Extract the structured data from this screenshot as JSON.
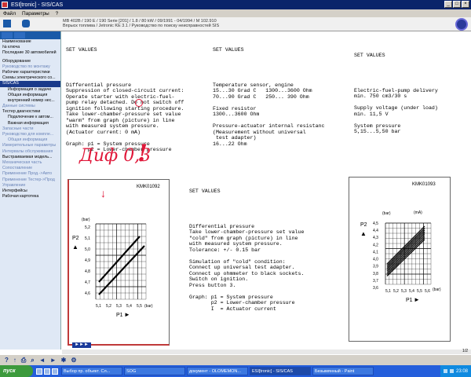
{
  "window": {
    "title": "ESI[tronic] - SIS/CAS"
  },
  "menu": [
    "Файл",
    "Параметры",
    "?"
  ],
  "header": {
    "info_line1": "MB 402B / 190 E / 190 Serie [201] / 1.8 / 80 kW / 09/1991 - 04/1994 / M 102.910",
    "info_line2": "Впрыск топлива / Jetronic KE 3.1 / Руководство по поиску неисправностей SIS"
  },
  "sidebar": {
    "items": [
      {
        "label": "Наименование",
        "style": ""
      },
      {
        "label": "№ ключа",
        "style": ""
      },
      {
        "label": "Последние 30 автомобилей",
        "style": ""
      },
      {
        "label": "",
        "style": "gap"
      },
      {
        "label": "Оборудование",
        "style": ""
      },
      {
        "label": "Руководство по монтажу",
        "style": "dim"
      },
      {
        "label": "Рабочие характеристики",
        "style": ""
      },
      {
        "label": "Схемы электрического со...",
        "style": ""
      },
      {
        "label": "SIS/CAS",
        "style": "sel"
      },
      {
        "label": "Информация о задаче",
        "style": "ind"
      },
      {
        "label": "Общая информация",
        "style": "ind"
      },
      {
        "label": "внутренний номер нес...",
        "style": "ind"
      },
      {
        "label": "Данные системы",
        "style": "dim"
      },
      {
        "label": "Тестер диагностики",
        "style": ""
      },
      {
        "label": "Подключение к автом...",
        "style": "ind"
      },
      {
        "label": "Важная информация",
        "style": "ind"
      },
      {
        "label": "Запасные части",
        "style": "dim"
      },
      {
        "label": "Руководство для компле...",
        "style": "dim"
      },
      {
        "label": "Общая информация",
        "style": "ind dim"
      },
      {
        "label": "Измерительные параметры",
        "style": "dim"
      },
      {
        "label": "Интервалы обслуживания",
        "style": "dim"
      },
      {
        "label": "Выстраиваемая модель...",
        "style": ""
      },
      {
        "label": "Механическая часть",
        "style": "dim"
      },
      {
        "label": "Сопоставление",
        "style": "dim"
      },
      {
        "label": "Применение Прод.->Авто",
        "style": "dim"
      },
      {
        "label": "Применение Тестер->Прод",
        "style": "dim"
      },
      {
        "label": "Управление",
        "style": "dim"
      },
      {
        "label": "Интерфейсы",
        "style": ""
      },
      {
        "label": "Рабочая картотека",
        "style": ""
      }
    ]
  },
  "panel_left": {
    "heading": "SET VALUES",
    "lines": [
      "Differential pressure",
      "Suppression of closed-circuit current:",
      "Operate starter with electric-fuel-",
      "pump relay detached. Do not switch off",
      "ignition following starting procedure.",
      "Take lower-chamber-pressure set value",
      "\"warm\" from graph (picture) in line",
      "with measured system pressure.",
      "(Actuator current: 0 mA)",
      "",
      "Graph: p1 = System pressure",
      "       p2 = Lower-chamber pressure"
    ]
  },
  "panel_mid": {
    "heading": "SET VALUES",
    "lines": [
      "Temperature sensor, engine",
      "15...30 Grad C   1300...3600 Ohm",
      "70...90 Grad C   250... 390 Ohm",
      "",
      "Fixed resistor",
      "1300...3600 Ohm",
      "",
      "Pressure-actuator internal resistanc",
      "(Measurement without universal",
      " test adapter)",
      "16...22 Ohm"
    ]
  },
  "panel_right": {
    "heading": "SET VALUES",
    "lines": [
      "Electric-fuel-pump delivery",
      "min. 750 cm3/30 s",
      "",
      "Supply voltage (under load)",
      "min. 11,5 V",
      "",
      "System pressure",
      "5,15...5,50 bar"
    ]
  },
  "panel_center": {
    "heading": "SET VALUES",
    "lines": [
      "Differential pressure",
      "Take lower-chamber-pressure set value",
      "\"cold\" from graph (picture) in line",
      "with measured system pressure.",
      "Tolerance: +/- 0.15 bar",
      "",
      "Simulation of \"cold\" condition:",
      "Connect up universal test adapter.",
      "Connect up ohmmeter to black sockets.",
      "Switch on ignition.",
      "Press button 3.",
      "",
      "Graph: p1 = System pressure",
      "       p2 = Lower-chamber pressure",
      "       I  = Actuator current"
    ]
  },
  "annotation": {
    "text": "Диф 0,3",
    "mark": "!",
    "color": "#e0183a"
  },
  "graph_left": {
    "code": "KMK01092",
    "y_ticks": [
      "5,2",
      "5,1",
      "5,0",
      "4,9",
      "4,8",
      "4,7",
      "4,6"
    ],
    "x_ticks": [
      "5,1",
      "5,2",
      "5,3",
      "5,4",
      "5,5"
    ],
    "y_unit": "(bar)",
    "x_unit": "(bar)",
    "y_label": "P2",
    "x_label": "P1"
  },
  "graph_right": {
    "code": "KMK01093",
    "y_ticks": [
      "4,5",
      "4,4",
      "4,3",
      "4,2",
      "4,1",
      "4,0",
      "3,9",
      "3,8",
      "3,7",
      "3,6"
    ],
    "x_ticks": [
      "5,1",
      "5,2",
      "5,3",
      "5,4",
      "5,5",
      "5,6"
    ],
    "y_unit": "(bar)",
    "x_unit": "(bar)",
    "i_unit": "(mA)",
    "y_label": "P2",
    "x_label": "P1"
  },
  "status": {
    "page": "1/2"
  },
  "taskbar": {
    "start": "пуск",
    "buttons": [
      "Выбор пр. объект. Сл...",
      "SOG",
      "документ - OLOMEMON...",
      "ESI[tronic] - SIS/CAS",
      "Безымянный - Paint"
    ],
    "active_index": 3,
    "clock": "23:08"
  }
}
